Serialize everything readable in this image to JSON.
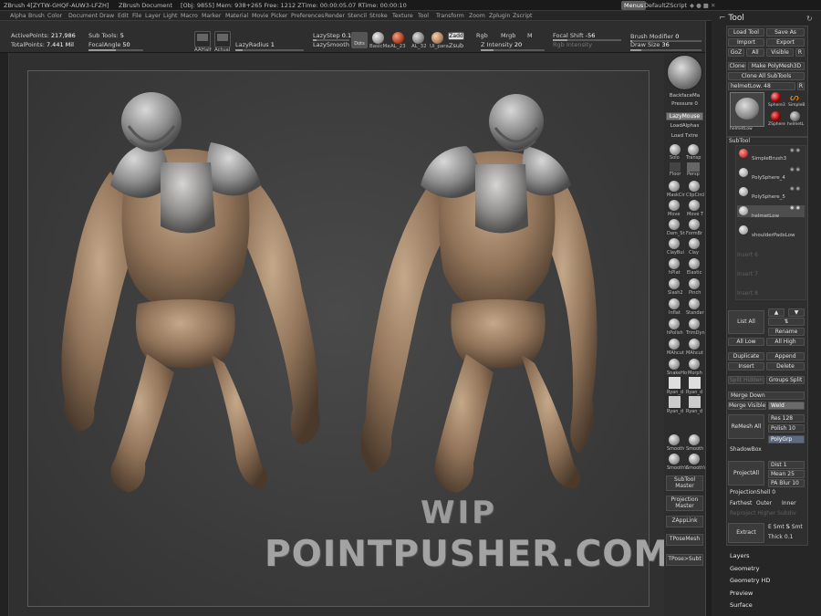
{
  "titlebar": {
    "app": "ZBrush 4[ZYTW-GHQF-AUW3-LFZH]",
    "document": "ZBrush Document",
    "stats": "[Obj: 9855] Mem: 938+265 Free: 1212 ZTime: 00:00:05.07 RTime: 00:00:10",
    "menus_label": "Menus",
    "script_label": "DefaultZScript"
  },
  "menubar": [
    "Alpha",
    "Brush",
    "Color",
    "Document",
    "Draw",
    "Edit",
    "File",
    "Layer",
    "Light",
    "Macro",
    "Marker",
    "Material",
    "Movie",
    "Picker",
    "Preferences",
    "Render",
    "Stencil",
    "Stroke",
    "Texture",
    "Tool",
    "Transform",
    "Zoom",
    "Zplugin",
    "Zscript"
  ],
  "topshelf": {
    "active_points_label": "ActivePoints:",
    "active_points": "217,986",
    "total_points_label": "TotalPoints:",
    "total_points": "7.441 Mil",
    "subtools_label": "Sub Tools:",
    "subtools": "5",
    "focal_angle_label": "FocalAngle",
    "focal_angle": "50",
    "aahalf": "AAHalf",
    "actual": "Actual",
    "lazy_radius_label": "LazyRadius",
    "lazy_radius": "1",
    "lazy_step_label": "LazyStep",
    "lazy_step": "0.1",
    "lazy_smooth_label": "LazySmooth",
    "stroke_label": "Dots",
    "mat1": "BasicMa",
    "mat2": "AL_23",
    "mat3": "AL_32",
    "mat4": "UI_para",
    "zadd": "Zadd",
    "zsub": "Zsub",
    "rgb": "Rgb",
    "mrgb": "Mrgb",
    "m": "M",
    "z_intensity_label": "Z Intensity",
    "z_intensity": "20",
    "focal_shift_label": "Focal Shift",
    "focal_shift": "-56",
    "rgb_intensity_label": "Rgb Intensity",
    "brush_modifier_label": "Brush Modifier",
    "brush_modifier": "0",
    "draw_size_label": "Draw Size",
    "draw_size": "36"
  },
  "brushcol": {
    "backface": "BackfaceMa",
    "pressure_label": "Pressure",
    "pressure": "0",
    "lazymouse": "LazyMouse",
    "loadalphas": "LoadAlphas",
    "loadtxtre": "Load Txtre",
    "solo": "Solo",
    "transp": "Transp",
    "floor": "Floor",
    "persp": "Persp",
    "brushes": [
      "MaskCir",
      "ClipCircl",
      "Move",
      "Move T",
      "Dam_St",
      "FormBr",
      "ClayBui",
      "Clay",
      "hPlat",
      "Elastic",
      "Slash2",
      "Pinch",
      "Inflat",
      "Standar",
      "hPolish",
      "TrimDyn",
      "MAhcut",
      "MAhcut",
      "SnakeHo",
      "Morph",
      "Ryan_d",
      "Ryan_d",
      "Ryan_d",
      "Ryan_d",
      "Smooth",
      "Smooth",
      "SmoothV",
      "SmoothV"
    ],
    "subtool_master": "SubTool Master",
    "projection_master": "Projection Master",
    "zapplink": "ZAppLink",
    "tpose_mesh": "TPoseMesh",
    "tpose_sub": "TPose>Subt"
  },
  "tool": {
    "title": "Tool",
    "load_tool": "Load Tool",
    "save_as": "Save As",
    "import": "Import",
    "export": "Export",
    "goz": "GoZ",
    "all": "All",
    "visible": "Visible",
    "r": "R",
    "clone": "Clone",
    "make_polymesh": "Make PolyMesh3D",
    "clone_all": "Clone All SubTools",
    "current_tool": "helmetLow. 48",
    "thumb1": "helmetLow",
    "thumb2": "Sphere3",
    "thumb3": "SimpleB",
    "thumb4": "ZSphere",
    "thumb5": "helmetL",
    "subtool_header": "SubTool",
    "subtools": [
      "SimpleBrush3",
      "PolySphere_4",
      "PolySphere_5",
      "helmetLow",
      "shoulderPadsLow"
    ],
    "empty_slots": [
      "Insert 6",
      "Insert 7",
      "Insert 8"
    ],
    "list_all": "List All",
    "rename": "Rename",
    "all_low": "All Low",
    "all_high": "All High",
    "duplicate": "Duplicate",
    "append": "Append",
    "insert": "Insert",
    "delete": "Delete",
    "split_hidden": "Split Hidden",
    "groups_split": "Groups Split",
    "merge_down": "Merge Down",
    "merge_visible": "Merge Visible",
    "weld": "Weld",
    "remesh_all": "ReMesh All",
    "res_label": "Res",
    "res": "128",
    "polish_label": "Polish",
    "polish": "10",
    "polygrp": "PolyGrp",
    "shadowbox": "ShadowBox",
    "projectall": "ProjectAll",
    "dist_label": "Dist",
    "dist": "1",
    "mean_label": "Mean",
    "mean": "25",
    "pa_blur_label": "PA Blur",
    "pa_blur": "10",
    "projection_shell_label": "ProjectionShell",
    "projection_shell": "0",
    "farthest": "Farthest",
    "outer": "Outer",
    "inner": "Inner",
    "reproject": "Reproject Higher Subdiv",
    "extract": "Extract",
    "e_smt_label": "E Smt",
    "e_smt": "5",
    "s_smt_label": "S Smt",
    "s_smt": "",
    "thick_label": "Thick",
    "thick": "0.1",
    "bottom": [
      "Layers",
      "Geometry",
      "Geometry HD",
      "Preview",
      "Surface"
    ]
  },
  "watermark": {
    "line1": "WIP",
    "line2": "POINTPUSHER.COM"
  }
}
